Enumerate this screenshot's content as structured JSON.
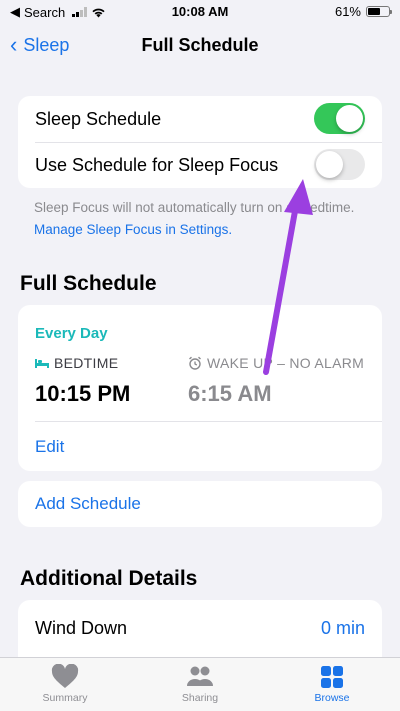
{
  "status_bar": {
    "carrier": "Search",
    "time": "10:08 AM",
    "battery": "61%",
    "battery_level": 0.61
  },
  "nav": {
    "back_label": "Sleep",
    "title": "Full Schedule"
  },
  "settings": {
    "sleep_schedule_label": "Sleep Schedule",
    "sleep_schedule_on": true,
    "sleep_focus_label": "Use Schedule for Sleep Focus",
    "sleep_focus_on": false
  },
  "footnote": {
    "text": "Sleep Focus will not automatically turn on at Bedtime. ",
    "link": "Manage Sleep Focus in Settings."
  },
  "full_schedule": {
    "section_title": "Full Schedule",
    "days": "Every Day",
    "bedtime_label": "BEDTIME",
    "bedtime_time": "10:15 PM",
    "wake_label": "WAKE UP – NO ALARM",
    "wake_time": "6:15 AM",
    "edit_label": "Edit",
    "add_label": "Add Schedule"
  },
  "additional": {
    "section_title": "Additional Details",
    "wind_down_label": "Wind Down",
    "wind_down_value": "0 min"
  },
  "tabbar": {
    "summary": "Summary",
    "sharing": "Sharing",
    "browse": "Browse"
  },
  "colors": {
    "accent": "#1a73e8",
    "toggle_on": "#34c759",
    "schedule_teal": "#1bb9b9",
    "annotation_arrow": "#9b3fe0"
  }
}
